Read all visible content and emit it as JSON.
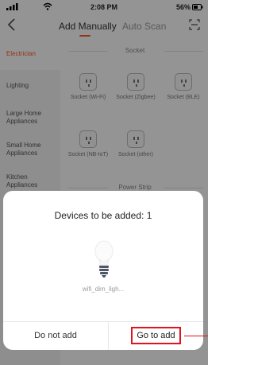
{
  "status_bar": {
    "time": "2:08 PM",
    "battery": "56%"
  },
  "nav": {
    "tabs": [
      {
        "label": "Add Manually",
        "active": true
      },
      {
        "label": "Auto Scan",
        "active": false
      }
    ]
  },
  "sidebar": {
    "items": [
      {
        "label": "Electrician",
        "active": true
      },
      {
        "label": "Lighting",
        "active": false
      },
      {
        "label": "Large Home Appliances",
        "active": false
      },
      {
        "label": "Small Home Appliances",
        "active": false
      },
      {
        "label": "Kitchen Appliances",
        "active": false
      }
    ]
  },
  "content": {
    "sections": [
      {
        "title": "Socket",
        "items": [
          {
            "label": "Socket (Wi-Fi)"
          },
          {
            "label": "Socket (Zigbee)"
          },
          {
            "label": "Socket (BLE)"
          },
          {
            "label": "Socket (NB-IoT)"
          },
          {
            "label": "Socket (other)"
          }
        ]
      },
      {
        "title": "Power Strip",
        "items": []
      }
    ]
  },
  "dialog": {
    "title": "Devices to be added: 1",
    "device_name": "wifi_dim_ligh...",
    "cancel_label": "Do not add",
    "confirm_label": "Go to add"
  },
  "colors": {
    "accent": "#ff5a28",
    "highlight": "#e0141e"
  }
}
